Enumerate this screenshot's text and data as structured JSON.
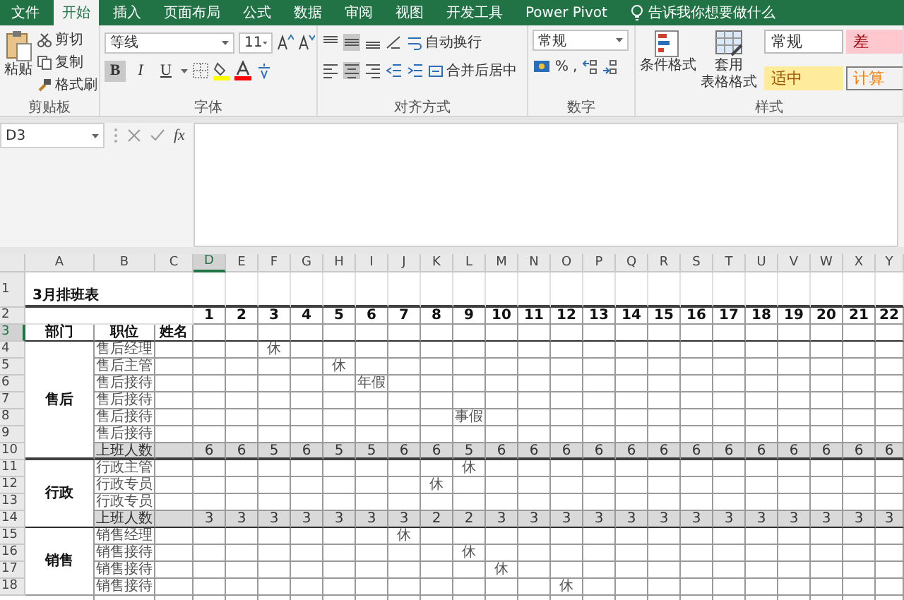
{
  "tabs": [
    {
      "label": "文件",
      "selected": false
    },
    {
      "label": "开始",
      "selected": true
    },
    {
      "label": "插入",
      "selected": false
    },
    {
      "label": "页面布局",
      "selected": false
    },
    {
      "label": "公式",
      "selected": false
    },
    {
      "label": "数据",
      "selected": false
    },
    {
      "label": "审阅",
      "selected": false
    },
    {
      "label": "视图",
      "selected": false
    },
    {
      "label": "开发工具",
      "selected": false
    },
    {
      "label": "Power Pivot",
      "selected": false
    }
  ],
  "tell_me": "告诉我你想要做什么",
  "clipboard": {
    "label": "剪贴板",
    "paste": "粘贴",
    "actions": [
      "剪切",
      "复制",
      "格式刷"
    ]
  },
  "font": {
    "label": "字体",
    "name": "等线",
    "size": "11",
    "styles": [
      {
        "label": "B",
        "kind": "bold",
        "pressed": true
      },
      {
        "label": "I",
        "kind": "italic",
        "pressed": false
      },
      {
        "label": "U",
        "kind": "underline",
        "pressed": false
      }
    ]
  },
  "alignment": {
    "label": "对齐方式",
    "wrap": "自动换行",
    "merge": "合并后居中"
  },
  "number": {
    "label": "数字",
    "format": "常规",
    "percent": "%",
    "comma": ","
  },
  "styles": {
    "label": "样式",
    "conditional": "条件格式",
    "table_format": [
      "套用",
      "表格格式"
    ],
    "cells": [
      {
        "label": "常规",
        "kind": "normal"
      },
      {
        "label": "差",
        "kind": "bad"
      },
      {
        "label": "适中",
        "kind": "neutral"
      },
      {
        "label": "计算",
        "kind": "calculation"
      }
    ]
  },
  "formula_bar": {
    "name_box": "D3",
    "fx": "fx"
  },
  "sheet": {
    "columns": [
      {
        "label": "A",
        "selected": false
      },
      {
        "label": "B",
        "selected": false
      },
      {
        "label": "C",
        "selected": false
      },
      {
        "label": "D",
        "selected": true
      },
      {
        "label": "E",
        "selected": false
      },
      {
        "label": "F",
        "selected": false
      },
      {
        "label": "G",
        "selected": false
      },
      {
        "label": "H",
        "selected": false
      },
      {
        "label": "I",
        "selected": false
      },
      {
        "label": "J",
        "selected": false
      },
      {
        "label": "K",
        "selected": false
      },
      {
        "label": "L",
        "selected": false
      },
      {
        "label": "M",
        "selected": false
      },
      {
        "label": "N",
        "selected": false
      },
      {
        "label": "O",
        "selected": false
      },
      {
        "label": "P",
        "selected": false
      },
      {
        "label": "Q",
        "selected": false
      },
      {
        "label": "R",
        "selected": false
      },
      {
        "label": "S",
        "selected": false
      },
      {
        "label": "T",
        "selected": false
      },
      {
        "label": "U",
        "selected": false
      },
      {
        "label": "V",
        "selected": false
      },
      {
        "label": "W",
        "selected": false
      },
      {
        "label": "X",
        "selected": false
      },
      {
        "label": "Y",
        "selected": false
      }
    ],
    "rows": [
      {
        "label": "1",
        "selected": false
      },
      {
        "label": "2",
        "selected": false
      },
      {
        "label": "3",
        "selected": true
      },
      {
        "label": "4",
        "selected": false
      },
      {
        "label": "5",
        "selected": false
      },
      {
        "label": "6",
        "selected": false
      },
      {
        "label": "7",
        "selected": false
      },
      {
        "label": "8",
        "selected": false
      },
      {
        "label": "9",
        "selected": false
      },
      {
        "label": "10",
        "selected": false
      },
      {
        "label": "11",
        "selected": false
      },
      {
        "label": "12",
        "selected": false
      },
      {
        "label": "13",
        "selected": false
      },
      {
        "label": "14",
        "selected": false
      },
      {
        "label": "15",
        "selected": false
      },
      {
        "label": "16",
        "selected": false
      },
      {
        "label": "17",
        "selected": false
      },
      {
        "label": "18",
        "selected": false
      }
    ],
    "title": "3月排班表",
    "days": [
      "1",
      "2",
      "3",
      "4",
      "5",
      "6",
      "7",
      "8",
      "9",
      "10",
      "11",
      "12",
      "13",
      "14",
      "15",
      "16",
      "17",
      "18",
      "19",
      "20",
      "21",
      "22"
    ],
    "headings": [
      "部门",
      "职位",
      "姓名"
    ],
    "departments": [
      {
        "name": "售后",
        "staff": [
          {
            "position": "售后经理",
            "cells": [
              null,
              null,
              "休"
            ]
          },
          {
            "position": "售后主管",
            "cells": [
              null,
              null,
              null,
              null,
              "休"
            ]
          },
          {
            "position": "售后接待",
            "cells": [
              null,
              null,
              null,
              null,
              null,
              "年假"
            ]
          },
          {
            "position": "售后接待"
          },
          {
            "position": "售后接待",
            "cells": [
              null,
              null,
              null,
              null,
              null,
              null,
              null,
              null,
              "事假"
            ]
          },
          {
            "position": "售后接待"
          }
        ],
        "total_label": "上班人数",
        "totals": [
          "6",
          "6",
          "5",
          "6",
          "5",
          "5",
          "6",
          "6",
          "5",
          "6",
          "6",
          "6",
          "6",
          "6",
          "6",
          "6",
          "6",
          "6",
          "6",
          "6",
          "6",
          "6"
        ]
      },
      {
        "name": "行政",
        "staff": [
          {
            "position": "行政主管",
            "cells": [
              null,
              null,
              null,
              null,
              null,
              null,
              null,
              null,
              "休"
            ]
          },
          {
            "position": "行政专员",
            "cells": [
              null,
              null,
              null,
              null,
              null,
              null,
              null,
              "休"
            ]
          },
          {
            "position": "行政专员"
          }
        ],
        "total_label": "上班人数",
        "totals": [
          "3",
          "3",
          "3",
          "3",
          "3",
          "3",
          "3",
          "2",
          "2",
          "3",
          "3",
          "3",
          "3",
          "3",
          "3",
          "3",
          "3",
          "3",
          "3",
          "3",
          "3",
          "3"
        ]
      },
      {
        "name": "销售",
        "staff": [
          {
            "position": "销售经理",
            "cells": [
              null,
              null,
              null,
              null,
              null,
              null,
              "休"
            ]
          },
          {
            "position": "销售接待",
            "cells": [
              null,
              null,
              null,
              null,
              null,
              null,
              null,
              null,
              "休"
            ]
          },
          {
            "position": "销售接待",
            "cells": [
              null,
              null,
              null,
              null,
              null,
              null,
              null,
              null,
              null,
              "休"
            ]
          },
          {
            "position": "销售接待",
            "cells": [
              null,
              null,
              null,
              null,
              null,
              null,
              null,
              null,
              null,
              null,
              null,
              "休"
            ]
          }
        ]
      }
    ]
  }
}
